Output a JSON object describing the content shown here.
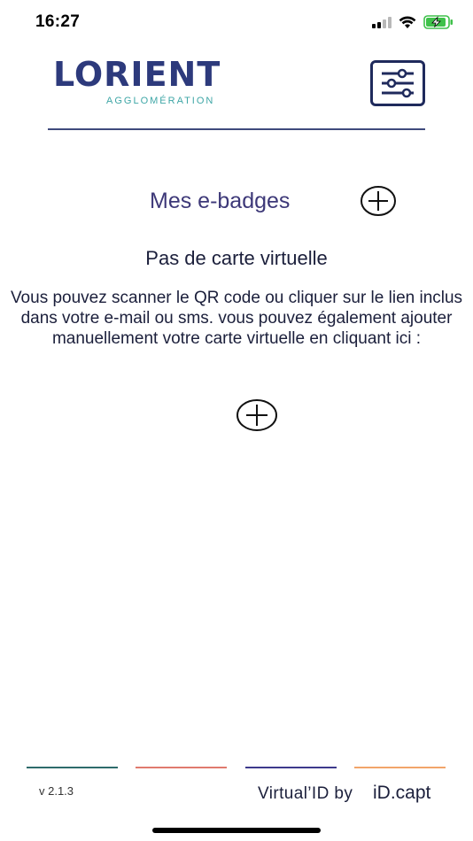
{
  "status_bar": {
    "time": "16:27"
  },
  "header": {
    "logo_text": "LORIENT",
    "logo_subtext": "AGGLOMÉRATION",
    "logo_color": "#2d3a7c",
    "logo_sub_color": "#3ea6a6"
  },
  "main": {
    "section_title": "Mes e-badges",
    "empty_title": "Pas de carte virtuelle",
    "empty_text": "Vous pouvez scanner le QR code ou cliquer sur le lien inclus dans votre e-mail ou sms. vous pouvez également ajouter manuellement votre carte virtuelle en cliquant ici :"
  },
  "footer": {
    "version": "v 2.1.3",
    "credit_text": "Virtual’ID by",
    "credit_brand": "iD.capt",
    "line_colors": [
      "#2e6b6b",
      "#e07a6e",
      "#3d3a8c",
      "#f2a56a"
    ]
  }
}
